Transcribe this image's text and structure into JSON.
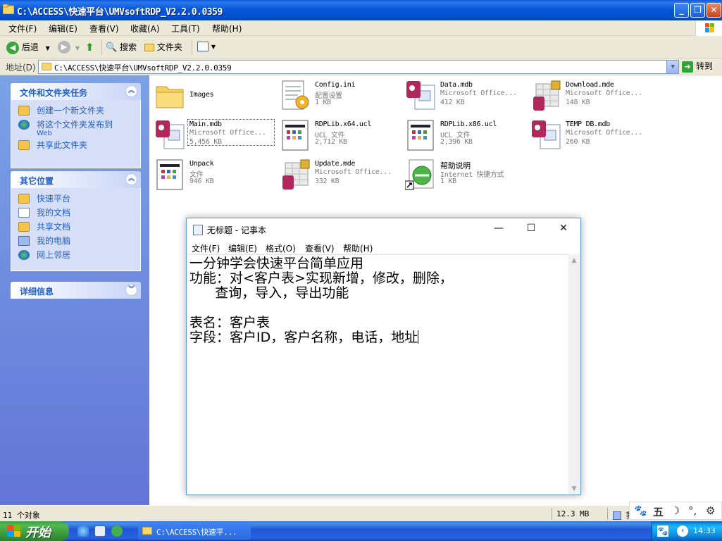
{
  "explorer": {
    "title": "C:\\ACCESS\\快速平台\\UMVsoftRDP_V2.2.0.0359",
    "menu": [
      "文件(F)",
      "编辑(E)",
      "查看(V)",
      "收藏(A)",
      "工具(T)",
      "帮助(H)"
    ],
    "toolbar": {
      "back": "后退",
      "search": "搜索",
      "folders": "文件夹"
    },
    "address_label": "地址(D)",
    "address_value": "C:\\ACCESS\\快速平台\\UMVsoftRDP_V2.2.0.0359",
    "go_label": "转到",
    "panels": {
      "tasks": {
        "title": "文件和文件夹任务",
        "items": [
          "创建一个新文件夹",
          "将这个文件夹发布到",
          "Web",
          "共享此文件夹"
        ]
      },
      "places": {
        "title": "其它位置",
        "items": [
          "快速平台",
          "我的文档",
          "共享文档",
          "我的电脑",
          "网上邻居"
        ]
      },
      "details": {
        "title": "详细信息"
      }
    },
    "files": [
      {
        "name": "Images",
        "type": "",
        "size": "",
        "icon": "folder-icon"
      },
      {
        "name": "Config.ini",
        "type": "配置设置",
        "size": "1 KB",
        "icon": "config-file-icon"
      },
      {
        "name": "Data.mdb",
        "type": "Microsoft Office...",
        "size": "412 KB",
        "icon": "access-db-icon"
      },
      {
        "name": "Download.mde",
        "type": "Microsoft Office...",
        "size": "148 KB",
        "icon": "access-mde-icon"
      },
      {
        "name": "Main.mdb",
        "type": "Microsoft Office...",
        "size": "5,456 KB",
        "icon": "access-db-icon"
      },
      {
        "name": "RDPLib.x64.ucl",
        "type": "UCL 文件",
        "size": "2,712 KB",
        "icon": "ucl-file-icon"
      },
      {
        "name": "RDPLib.x86.ucl",
        "type": "UCL 文件",
        "size": "2,396 KB",
        "icon": "ucl-file-icon"
      },
      {
        "name": "TEMP DB.mdb",
        "type": "Microsoft Office...",
        "size": "260 KB",
        "icon": "access-db-icon"
      },
      {
        "name": "Unpack",
        "type": "文件",
        "size": "946 KB",
        "icon": "generic-file-icon"
      },
      {
        "name": "Update.mde",
        "type": "Microsoft Office...",
        "size": "332 KB",
        "icon": "access-mde-icon"
      },
      {
        "name": "帮助说明",
        "type": "Internet 快捷方式",
        "size": "1 KB",
        "icon": "internet-shortcut-icon"
      }
    ],
    "status": {
      "count": "11 个对象",
      "size": "12.3 MB",
      "location": "我"
    }
  },
  "notepad": {
    "title": "无标题 - 记事本",
    "menu": [
      "文件(F)",
      "编辑(E)",
      "格式(O)",
      "查看(V)",
      "帮助(H)"
    ],
    "content": "一分钟学会快速平台简单应用\n功能：对<客户表>实现新增，修改，删除，\n      查询，导入，导出功能\n\n表名：客户表\n字段：客户ID，客户名称，电话，地址"
  },
  "taskbar": {
    "start_label": "开始",
    "window_button": "C:\\ACCESS\\快速平...",
    "clock": "14:33"
  },
  "ime": {
    "mode": "五"
  }
}
